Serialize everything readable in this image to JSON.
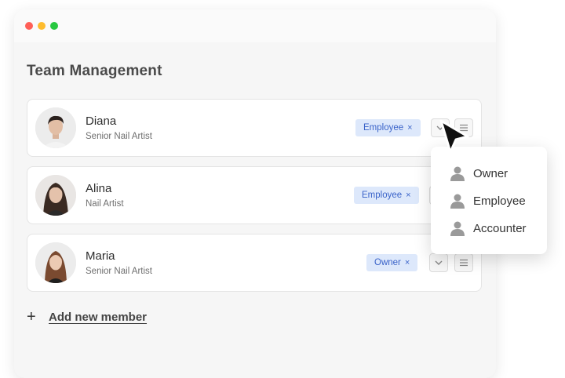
{
  "page": {
    "title": "Team Management"
  },
  "members": [
    {
      "name": "Diana",
      "role": "Senior Nail Artist",
      "badge": "Employee"
    },
    {
      "name": "Alina",
      "role": "Nail Artist",
      "badge": "Employee"
    },
    {
      "name": "Maria",
      "role": "Senior Nail Artist",
      "badge": "Owner"
    }
  ],
  "badge_remove_symbol": "×",
  "add_member": {
    "icon": "+",
    "label": "Add new member"
  },
  "role_menu": {
    "options": [
      "Owner",
      "Employee",
      "Accounter"
    ]
  },
  "colors": {
    "badge_bg": "#dde8fb",
    "badge_text": "#3a63c9",
    "window_bg": "#f6f6f6"
  },
  "icons": {
    "badge_remove": "close-icon",
    "expand": "chevron-down-icon",
    "menu": "hamburger-icon",
    "menu_option": "user-icon",
    "pointer": "cursor-arrow-icon"
  }
}
